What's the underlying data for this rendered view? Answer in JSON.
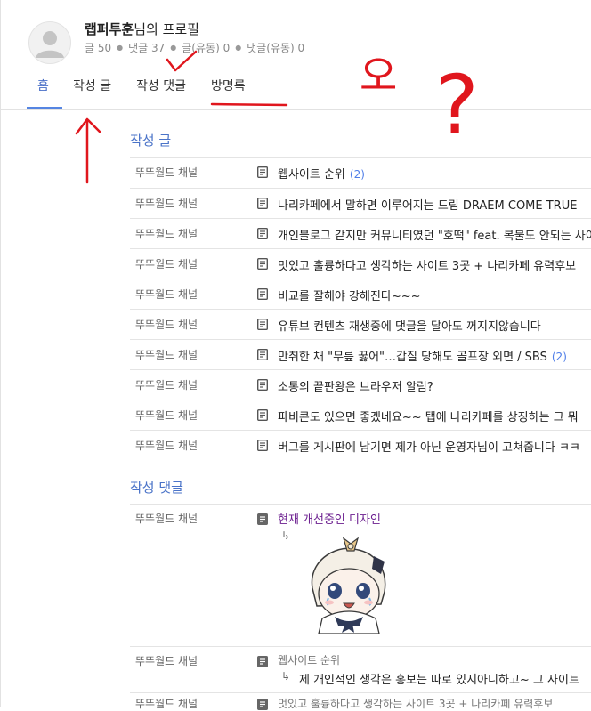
{
  "profile": {
    "nickname": "랩퍼투훈",
    "suffix": "님의 프로필",
    "stats": [
      {
        "label": "글 50"
      },
      {
        "label": "댓글 37"
      },
      {
        "label": "글(유동) 0"
      },
      {
        "label": "댓글(유동) 0"
      }
    ]
  },
  "tabs": [
    {
      "label": "홈",
      "active": true
    },
    {
      "label": "작성 글",
      "active": false
    },
    {
      "label": "작성 댓글",
      "active": false
    },
    {
      "label": "방명록",
      "active": false
    }
  ],
  "posts_section": {
    "title": "작성 글",
    "rows": [
      {
        "board": "뚜뚜월드 채널",
        "title": "웹사이트 순위",
        "count": "(2)"
      },
      {
        "board": "뚜뚜월드 채널",
        "title": "나리카페에서 말하면 이루어지는 드림 DRAEM COME TRUE",
        "count": ""
      },
      {
        "board": "뚜뚜월드 채널",
        "title": "개인블로그 같지만 커뮤니티였던 \"호떡\" feat. 복불도 안되는 사이트",
        "count": ""
      },
      {
        "board": "뚜뚜월드 채널",
        "title": "멋있고 훌륭하다고 생각하는 사이트 3곳 + 나리카페 유력후보",
        "count": ""
      },
      {
        "board": "뚜뚜월드 채널",
        "title": "비교를 잘해야 강해진다~~~",
        "count": ""
      },
      {
        "board": "뚜뚜월드 채널",
        "title": "유튜브 컨텐츠 재생중에 댓글을 달아도 꺼지지않습니다",
        "count": ""
      },
      {
        "board": "뚜뚜월드 채널",
        "title": "만취한 채 \"무릎 꿇어\"…갑질 당해도 골프장 외면 / SBS",
        "count": "(2)"
      },
      {
        "board": "뚜뚜월드 채널",
        "title": "소통의 끝판왕은 브라우저 알림?",
        "count": ""
      },
      {
        "board": "뚜뚜월드 채널",
        "title": "파비콘도 있으면 좋겠네요~~ 탭에 나리카페를 상징하는 그 뭐",
        "count": ""
      },
      {
        "board": "뚜뚜월드 채널",
        "title": "버그를 게시판에 남기면 제가 아닌 운영자님이 고쳐줍니다 ㅋㅋ",
        "count": ""
      }
    ]
  },
  "comments_section": {
    "title": "작성 댓글",
    "rows": [
      {
        "board": "뚜뚜월드 채널",
        "title": "현재 개선중인 디자인",
        "reply_arrow": "↳",
        "reply": ""
      },
      {
        "board": "뚜뚜월드 채널",
        "title": "웹사이트 순위",
        "reply_arrow": "↳",
        "reply": "제 개인적인 생각은 홍보는 따로 있지아니하고~ 그 사이트"
      },
      {
        "board": "뚜뚜월드 채널",
        "title": "멋있고 훌륭하다고 생각하는 사이트 3곳 + 나리카페 유력후보",
        "reply_arrow": "",
        "reply": ""
      }
    ]
  },
  "annotations": {
    "handwritten_text": "오",
    "question_mark": "?"
  },
  "colors": {
    "accent": "#4a73c8",
    "tab_underline": "#5585e2",
    "count_blue": "#4f7ee8",
    "visited_title": "#6b1e8f",
    "annotation_red": "#e0161d"
  }
}
